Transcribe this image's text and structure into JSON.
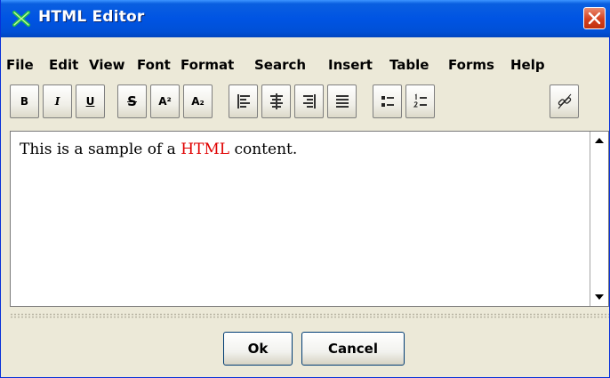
{
  "window": {
    "title": "HTML Editor"
  },
  "menu": [
    "File",
    "Edit",
    "View",
    "Font",
    "Format",
    "Search",
    "Insert",
    "Table",
    "Forms",
    "Help"
  ],
  "toolbar": {
    "bold": "B",
    "italic": "I",
    "underline": "U",
    "strike": "S",
    "superscript": "A²",
    "subscript": "A₂"
  },
  "editor": {
    "text_before": "This is a sample of a ",
    "text_highlight": "HTML",
    "text_after": " content.",
    "highlight_color": "#e00000"
  },
  "buttons": {
    "ok": "Ok",
    "cancel": "Cancel"
  },
  "icons": [
    "app-icon",
    "close-icon",
    "align-left-icon",
    "align-center-icon",
    "align-right-icon",
    "justify-icon",
    "bullet-list-icon",
    "numbered-list-icon",
    "link-icon",
    "scroll-up-icon",
    "scroll-down-icon"
  ]
}
